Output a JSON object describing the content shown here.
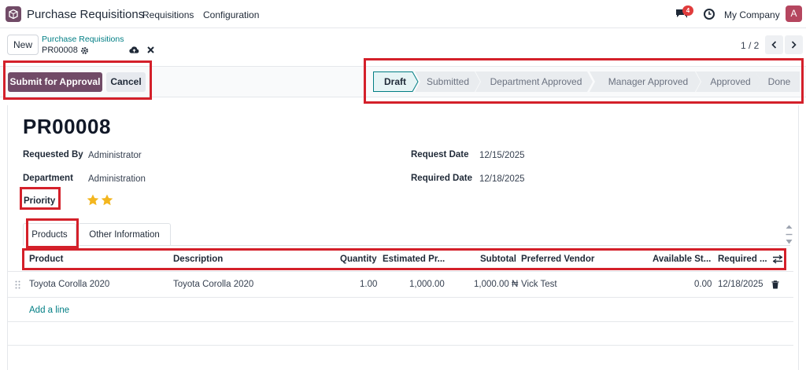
{
  "navbar": {
    "app_name": "Purchase Requisitions",
    "menus": [
      "Requisitions",
      "Configuration"
    ],
    "chat_badge": "4",
    "company": "My Company",
    "avatar_letter": "A"
  },
  "control_panel": {
    "new_label": "New",
    "breadcrumb_parent": "Purchase Requisitions",
    "breadcrumb_current": "PR00008",
    "pager": "1 / 2"
  },
  "actions": {
    "submit_label": "Submit for Approval",
    "cancel_label": "Cancel"
  },
  "statusbar": {
    "stages": [
      "Draft",
      "Submitted",
      "Department Approved",
      "Manager Approved",
      "Approved",
      "Done"
    ],
    "active_stage": "Draft"
  },
  "form": {
    "title": "PR00008",
    "requested_by_label": "Requested By",
    "requested_by_value": "Administrator",
    "department_label": "Department",
    "department_value": "Administration",
    "priority_label": "Priority",
    "priority_stars": 2,
    "request_date_label": "Request Date",
    "request_date_value": "12/15/2025",
    "required_date_label": "Required Date",
    "required_date_value": "12/18/2025"
  },
  "tabs": [
    "Products",
    "Other Information"
  ],
  "table": {
    "headers": [
      "Product",
      "Description",
      "Quantity",
      "Estimated Pr...",
      "Subtotal",
      "Preferred Vendor",
      "Available St...",
      "Required ..."
    ],
    "rows": [
      {
        "product": "Toyota Corolla 2020",
        "description": "Toyota Corolla 2020",
        "quantity": "1.00",
        "estimated_price": "1,000.00",
        "subtotal": "1,000.00 ₦",
        "vendor": "Vick Test",
        "available": "0.00",
        "required": "12/18/2025"
      }
    ],
    "add_line": "Add a line"
  },
  "colors": {
    "brand": "#714b67",
    "link": "#017e84",
    "highlight": "#d4202a",
    "star": "#f3b61f"
  }
}
